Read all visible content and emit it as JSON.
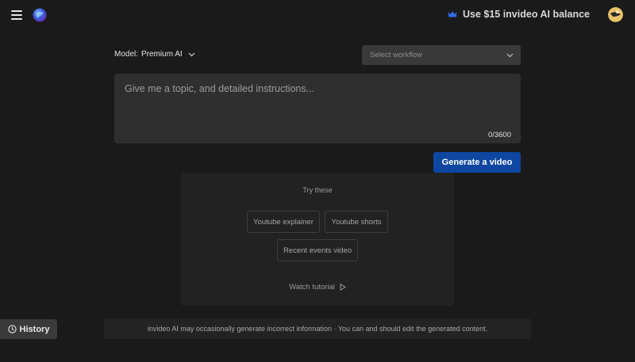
{
  "header": {
    "balance_label": "Use $15 invideo AI balance"
  },
  "model": {
    "label": "Model:",
    "value": "Premium AI"
  },
  "workflow": {
    "placeholder": "Select workflow"
  },
  "prompt": {
    "placeholder": "Give me a topic, and detailed instructions...",
    "value": "",
    "counter": "0/3600"
  },
  "generate_button": {
    "label": "Generate a video"
  },
  "suggestions": {
    "title": "Try these",
    "chips": [
      "Youtube explainer",
      "Youtube shorts",
      "Recent events video"
    ],
    "tutorial_label": "Watch tutorial"
  },
  "history": {
    "label": "History"
  },
  "disclaimer": {
    "text": "invideo AI may occasionally generate incorrect information · You can and should edit the generated content."
  },
  "colors": {
    "background": "#1a1a1a",
    "primary_button": "#0d47a1",
    "crown_icon": "#2f6ee8"
  }
}
